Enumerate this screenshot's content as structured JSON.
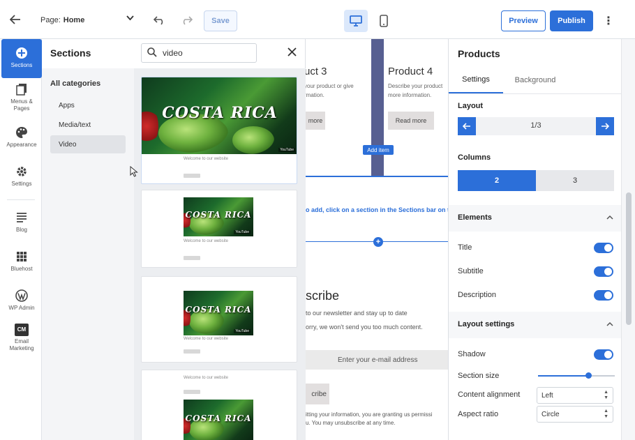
{
  "topbar": {
    "page_label": "Page:",
    "page_value": "Home",
    "save_label": "Save",
    "preview_label": "Preview",
    "publish_label": "Publish"
  },
  "rail": {
    "items": [
      {
        "label": "Sections",
        "icon": "plus-circle-icon"
      },
      {
        "label": "Menus &",
        "label2": "Pages",
        "icon": "pages-icon"
      },
      {
        "label": "Appearance",
        "icon": "palette-icon"
      },
      {
        "label": "Settings",
        "icon": "gear-icon"
      },
      {
        "label": "Blog",
        "icon": "blog-icon"
      },
      {
        "label": "Bluehost",
        "icon": "grid-icon"
      },
      {
        "label": "WP Admin",
        "icon": "wordpress-icon"
      },
      {
        "label": "Email",
        "label2": "Marketing",
        "badge": "CM",
        "icon": "cm-icon"
      }
    ]
  },
  "sections": {
    "title": "Sections",
    "search_value": "video",
    "categories_head": "All categories",
    "categories": [
      "Apps",
      "Media/text",
      "Video"
    ],
    "selected_category": "Video",
    "video_title": "COSTA RICA",
    "video_caption": "Welcome to our website",
    "video_source": "YouTube"
  },
  "canvas": {
    "product3": "uct 3",
    "product3_desc1": "your product or give",
    "product3_desc2": "rmation.",
    "product3_btn": "more",
    "product4": "Product 4",
    "product4_desc1": "Describe your product",
    "product4_desc2": "more information.",
    "product4_btn": "Read more",
    "add_item": "Add item",
    "drop_hint": "o add, click on a section in the Sections bar on the le",
    "subscribe_title": "scribe",
    "subscribe_text1": "to our newsletter and stay up to date",
    "subscribe_text2": "orry, we won't send you too much content.",
    "email_placeholder": "Enter your e-mail address",
    "subscribe_btn": "cribe",
    "fine1": "itting your information, you are granting us permissi",
    "fine2": "u. You may unsubscribe at any time."
  },
  "props": {
    "title": "Products",
    "tab_settings": "Settings",
    "tab_background": "Background",
    "layout_label": "Layout",
    "layout_pager": "1/3",
    "columns_label": "Columns",
    "columns_opt1": "2",
    "columns_opt2": "3",
    "columns_selected": "2",
    "elements_head": "Elements",
    "el_title": "Title",
    "el_subtitle": "Subtitle",
    "el_description": "Description",
    "layout_settings_head": "Layout settings",
    "shadow_label": "Shadow",
    "section_size_label": "Section size",
    "section_size_value": 0.65,
    "content_alignment_label": "Content alignment",
    "content_alignment_value": "Left",
    "aspect_ratio_label": "Aspect ratio",
    "aspect_ratio_value": "Circle"
  },
  "colors": {
    "accent": "#2c6fd9",
    "rail_active": "#2c6fd9",
    "product_strip": "#575f91"
  }
}
